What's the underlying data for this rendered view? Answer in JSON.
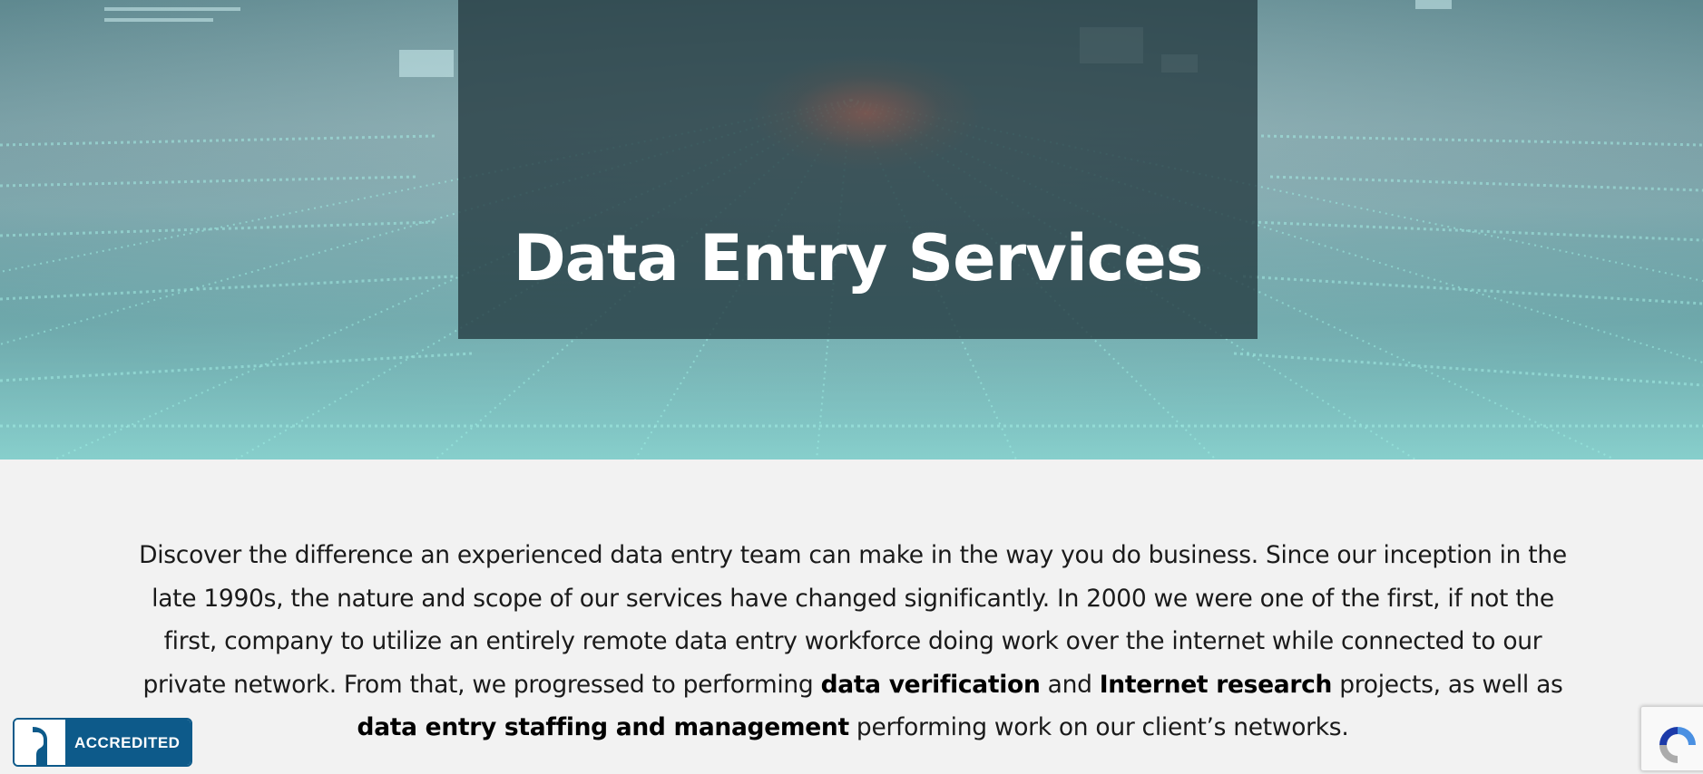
{
  "hero": {
    "title": "Data Entry Services"
  },
  "intro": {
    "part1": "Discover the difference an experienced data entry team can make in the way you do business. Since our inception in the late 1990s, the nature and scope of our services have changed significantly. In 2000 we were one of the first, if not the first, company to utilize an entirely remote data entry workforce doing work over the internet while connected to our private network. From that, we progressed to performing ",
    "link1": "data verification",
    "part2": " and ",
    "link2": "Internet research",
    "part3": " projects, as well as ",
    "link3": "data entry staffing and management",
    "part4": " performing work on our client’s networks."
  },
  "badge": {
    "label": "ACCREDITED",
    "icon": "bbb-torch-icon"
  },
  "recaptcha": {
    "icon": "recaptcha-icon"
  },
  "colors": {
    "hero_overlay": "#243a40",
    "badge_blue": "#0d5a8a",
    "page_background": "#f2f2f2"
  }
}
